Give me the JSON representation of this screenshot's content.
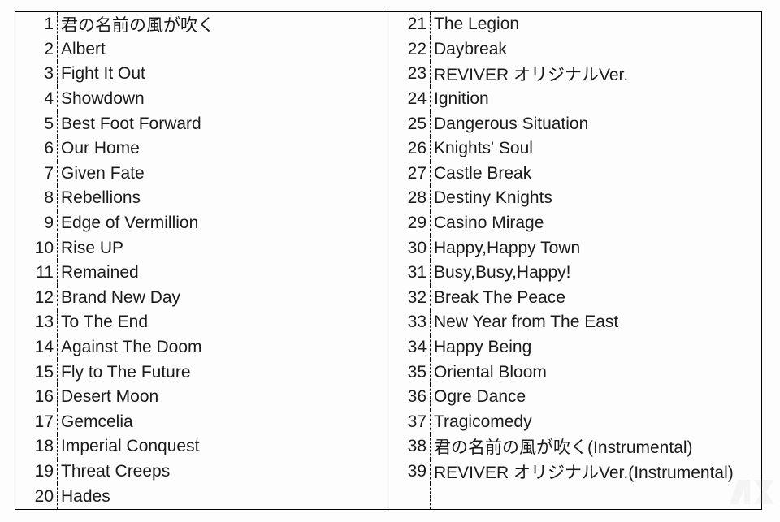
{
  "tracks_left": [
    {
      "num": "1",
      "title": "君の名前の風が吹く"
    },
    {
      "num": "2",
      "title": "Albert"
    },
    {
      "num": "3",
      "title": "Fight It Out"
    },
    {
      "num": "4",
      "title": "Showdown"
    },
    {
      "num": "5",
      "title": "Best Foot Forward"
    },
    {
      "num": "6",
      "title": "Our Home"
    },
    {
      "num": "7",
      "title": "Given Fate"
    },
    {
      "num": "8",
      "title": "Rebellions"
    },
    {
      "num": "9",
      "title": "Edge of Vermillion"
    },
    {
      "num": "10",
      "title": "Rise UP"
    },
    {
      "num": "11",
      "title": "Remained"
    },
    {
      "num": "12",
      "title": "Brand New Day"
    },
    {
      "num": "13",
      "title": "To The End"
    },
    {
      "num": "14",
      "title": "Against The Doom"
    },
    {
      "num": "15",
      "title": "Fly to The Future"
    },
    {
      "num": "16",
      "title": "Desert Moon"
    },
    {
      "num": "17",
      "title": "Gemcelia"
    },
    {
      "num": "18",
      "title": "Imperial Conquest"
    },
    {
      "num": "19",
      "title": "Threat Creeps"
    },
    {
      "num": "20",
      "title": "Hades"
    }
  ],
  "tracks_right": [
    {
      "num": "21",
      "title": "The Legion"
    },
    {
      "num": "22",
      "title": "Daybreak"
    },
    {
      "num": "23",
      "title": "REVIVER オリジナルVer."
    },
    {
      "num": "24",
      "title": "Ignition"
    },
    {
      "num": "25",
      "title": "Dangerous Situation"
    },
    {
      "num": "26",
      "title": "Knights' Soul"
    },
    {
      "num": "27",
      "title": "Castle Break"
    },
    {
      "num": "28",
      "title": "Destiny Knights"
    },
    {
      "num": "29",
      "title": "Casino Mirage"
    },
    {
      "num": "30",
      "title": "Happy,Happy Town"
    },
    {
      "num": "31",
      "title": "Busy,Busy,Happy!"
    },
    {
      "num": "32",
      "title": "Break The Peace"
    },
    {
      "num": "33",
      "title": "New Year from The East"
    },
    {
      "num": "34",
      "title": "Happy Being"
    },
    {
      "num": "35",
      "title": "Oriental Bloom"
    },
    {
      "num": "36",
      "title": "Ogre Dance"
    },
    {
      "num": "37",
      "title": "Tragicomedy"
    },
    {
      "num": "38",
      "title": "君の名前の風が吹く(Instrumental)"
    },
    {
      "num": "39",
      "title": "REVIVER オリジナルVer.(Instrumental)"
    },
    {
      "num": "",
      "title": ""
    }
  ]
}
